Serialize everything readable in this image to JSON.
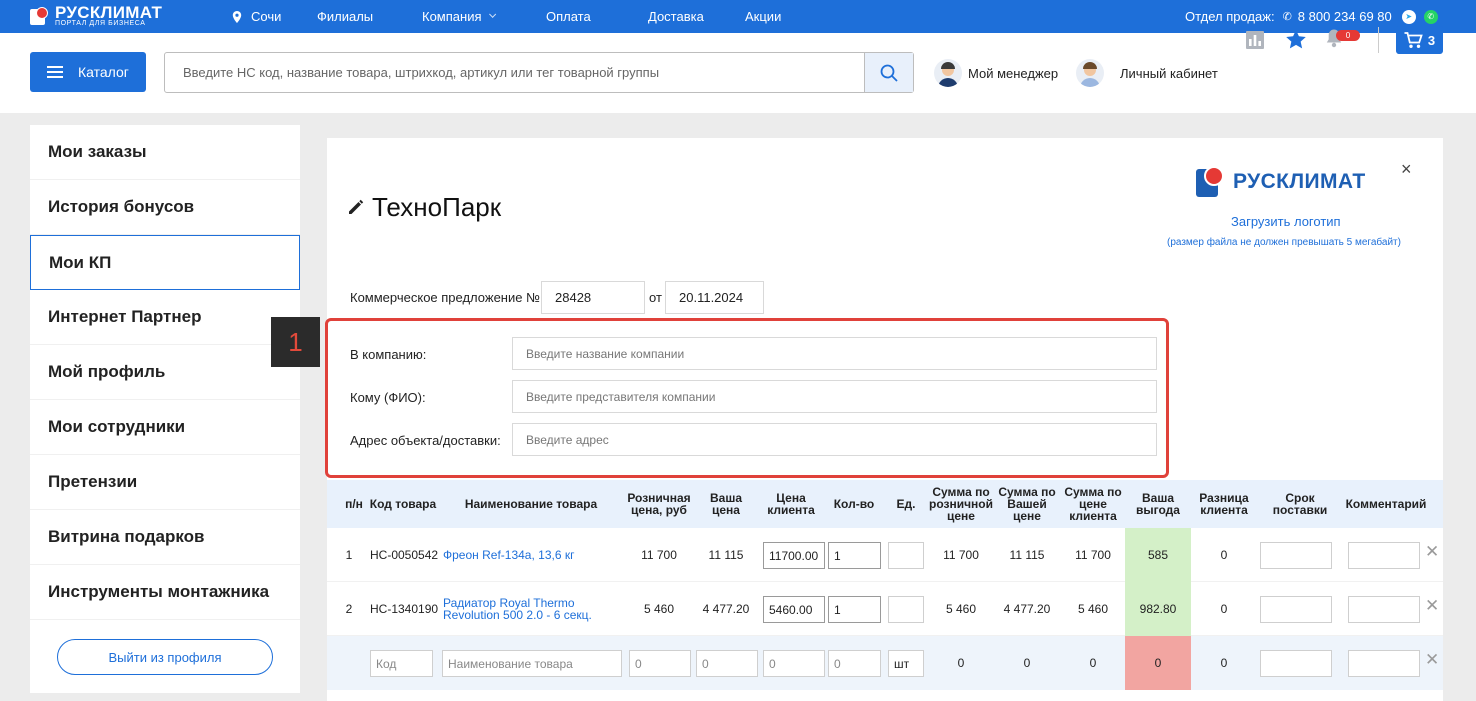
{
  "topbar": {
    "logo_name": "РУСКЛИМАТ",
    "logo_sub": "ПОРТАЛ ДЛЯ БИЗНЕСА",
    "city": "Сочи",
    "nav": [
      "Филиалы",
      "Компания",
      "Оплата",
      "Доставка",
      "Акции"
    ],
    "sales_label": "Отдел продаж:",
    "phone": "8 800 234 69 80",
    "icons": [
      "location-pin-icon",
      "chevron-down-icon",
      "phone-icon",
      "telegram-icon",
      "whatsapp-icon"
    ]
  },
  "header": {
    "catalog_label": "Каталог",
    "search_placeholder": "Введите НС код, название товара, штрихкод, артикул или тег товарной группы",
    "manager_label": "Мой менеджер",
    "cabinet_label": "Личный кабинет",
    "notifications_count": "0",
    "cart_count": "3",
    "icons": [
      "menu-icon",
      "search-icon",
      "stats-icon",
      "star-icon",
      "bell-icon",
      "cart-icon"
    ]
  },
  "sidebar": {
    "items": [
      {
        "label": "Мои заказы"
      },
      {
        "label": "История бонусов"
      },
      {
        "label": "Мои КП"
      },
      {
        "label": "Интернет Партнер"
      },
      {
        "label": "Мой профиль"
      },
      {
        "label": "Мои сотрудники"
      },
      {
        "label": "Претензии"
      },
      {
        "label": "Витрина подарков"
      },
      {
        "label": "Инструменты монтажника"
      }
    ],
    "active_index": 2,
    "logout_label": "Выйти из профиля"
  },
  "main": {
    "title": "ТехноПарк",
    "logo_name": "РУСКЛИМАТ",
    "upload_label": "Загрузить логотип",
    "upload_note": "(размер файла не должен превышать 5 мегабайт)",
    "close_label": "×",
    "kp_label": "Коммерческое предложение №",
    "kp_number": "28428",
    "kp_from": "от",
    "kp_date": "20.11.2024",
    "marker_label": "1",
    "fields": {
      "company": {
        "label": "В компанию:",
        "placeholder": "Введите название компании"
      },
      "recipient": {
        "label": "Кому (ФИО):",
        "placeholder": "Введите представителя компании"
      },
      "address": {
        "label": "Адрес объекта/доставки:",
        "placeholder": "Введите адрес"
      }
    },
    "colors": {
      "accent": "#1e6fd9",
      "highlight": "#e0413a",
      "benefit_positive": "#d4f0c8",
      "benefit_zero": "#f2a5a1"
    }
  },
  "table": {
    "headers": {
      "num": "п/н",
      "code": "Код товара",
      "name": "Наименование товара",
      "retail": "Розничная цена, руб",
      "your_price": "Ваша цена",
      "client_price": "Цена клиента",
      "qty": "Кол-во",
      "unit": "Ед.",
      "sum_retail": "Сумма по розничной цене",
      "sum_your": "Сумма по Вашей цене",
      "sum_client": "Сумма по цене клиента",
      "benefit": "Ваша выгода",
      "diff": "Разница клиента",
      "term": "Срок поставки",
      "comment": "Комментарий"
    },
    "rows": [
      {
        "num": "1",
        "code": "НС-0050542",
        "name": "Фреон Ref-134a, 13,6 кг",
        "retail": "11 700",
        "your_price": "11 115",
        "client_price": "11700.00",
        "qty": "1",
        "unit": "",
        "sum_retail": "11 700",
        "sum_your": "11 115",
        "sum_client": "11 700",
        "benefit": "585",
        "diff": "0",
        "term": "",
        "comment": ""
      },
      {
        "num": "2",
        "code": "НС-1340190",
        "name": "Радиатор Royal Thermo Revolution 500 2.0 - 6 секц.",
        "retail": "5 460",
        "your_price": "4 477.20",
        "client_price": "5460.00",
        "qty": "1",
        "unit": "",
        "sum_retail": "5 460",
        "sum_your": "4 477.20",
        "sum_client": "5 460",
        "benefit": "982.80",
        "diff": "0",
        "term": "",
        "comment": ""
      }
    ],
    "new_row": {
      "code_placeholder": "Код",
      "name_placeholder": "Наименование товара",
      "retail_placeholder": "0",
      "your_price_placeholder": "0",
      "client_price_placeholder": "0",
      "qty_placeholder": "0",
      "unit": "шт",
      "sum_retail": "0",
      "sum_your": "0",
      "sum_client": "0",
      "benefit": "0",
      "diff": "0"
    },
    "delete_label": "✕"
  }
}
